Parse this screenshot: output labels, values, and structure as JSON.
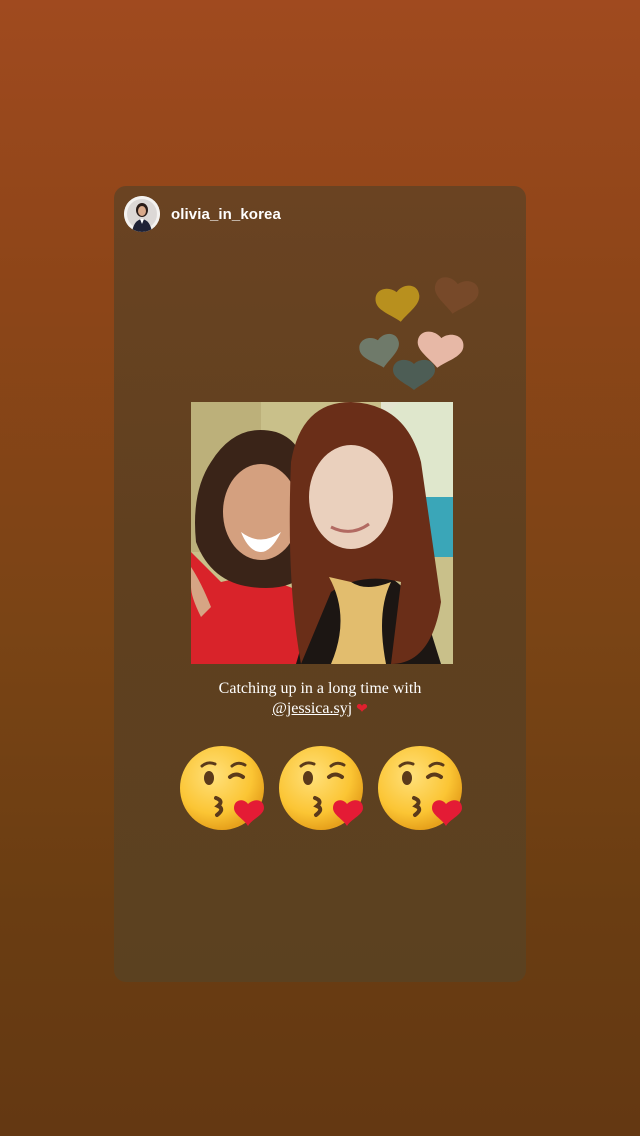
{
  "story": {
    "username": "olivia_in_korea",
    "caption_text": "Catching up in a long time with",
    "mention": "@jessica.syj",
    "caption_heart": "❤"
  },
  "stickers": {
    "hearts": [
      {
        "icon": "heart-icon",
        "color": "#b8901e"
      },
      {
        "icon": "heart-icon",
        "color": "#7a4a2a"
      },
      {
        "icon": "heart-icon",
        "color": "#6f7a6a"
      },
      {
        "icon": "heart-icon",
        "color": "#e7b8a6"
      },
      {
        "icon": "heart-icon",
        "color": "#4d5d55"
      }
    ],
    "emojis": [
      "kissing-face-icon",
      "kissing-face-icon",
      "kissing-face-icon"
    ]
  },
  "colors": {
    "background": "#8d4518",
    "card": "#62411f",
    "text": "#ffffff",
    "heart_red": "#e0202e"
  }
}
